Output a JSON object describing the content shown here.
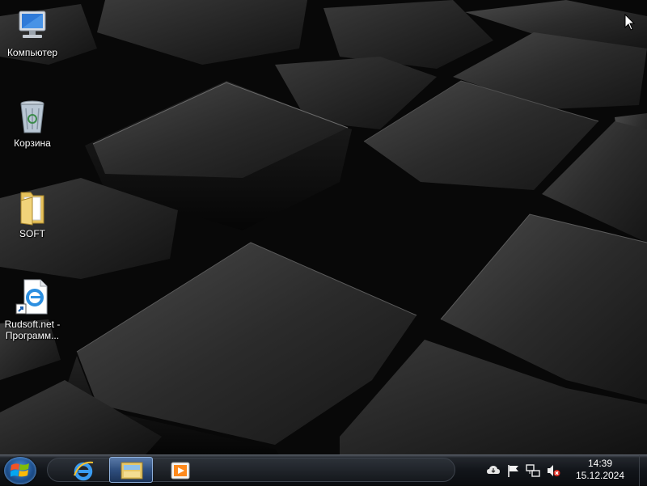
{
  "desktop": {
    "icons": [
      {
        "label": "Компьютер",
        "icon": "computer-icon"
      },
      {
        "label": "Корзина",
        "icon": "recycle-bin-icon"
      },
      {
        "label": "SOFT",
        "icon": "folder-icon"
      },
      {
        "label_line1": "Rudsoft.net -",
        "label_line2": "Программ...",
        "icon": "internet-shortcut-icon"
      }
    ]
  },
  "taskbar": {
    "start_icon": "windows-logo-icon",
    "pinned": [
      {
        "icon": "internet-explorer-icon",
        "active": false
      },
      {
        "icon": "file-explorer-icon",
        "active": true
      },
      {
        "icon": "media-player-icon",
        "active": false
      }
    ],
    "tray": {
      "icons": [
        "cloud-icon",
        "action-center-flag-icon",
        "network-icon",
        "volume-muted-icon"
      ]
    },
    "clock": {
      "time": "14:39",
      "date": "15.12.2024"
    }
  },
  "colors": {
    "taskbar": "#12151a",
    "start_orb": "#1d4e8c",
    "active_task": "#2f4f7e"
  }
}
